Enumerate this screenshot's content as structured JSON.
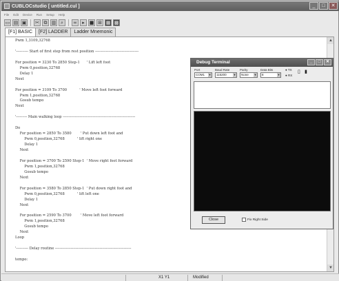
{
  "window": {
    "title": "CUBLOCstudio [ untitled.cul ]"
  },
  "menu": [
    "File",
    "Edit",
    "Device",
    "Run",
    "Setup",
    "Help"
  ],
  "toolbar": [
    "new",
    "open",
    "save",
    "cut",
    "copy",
    "paste",
    "find",
    "run",
    "stop",
    "ladder",
    "monitor",
    "dark-box"
  ],
  "tabs": [
    "[F1] BASIC",
    "[F2] LADDER",
    "Ladder Mnemonic"
  ],
  "code_lines": [
    "Pwm 1,3109,32768",
    "",
    "'---------- Start of first step from rest position ------------------------------------",
    "",
    "For position = 3230 To 2850 Step-1      ' Lift left foot",
    "    Pwm 0,position,32768",
    "    Delay 1",
    "Next",
    "",
    "For position = 3109 To 3700           ' Move left foot forward",
    "    Pwm 1,position,32768",
    "    Gosub tempo",
    "Next",
    "",
    "'--------- Main walking loop ------------------------------------------------------------",
    "",
    "Do",
    "    For position = 2850 To 3580        ' Put down left foot and",
    "        Pwm 0,position,32768           ' lift right one",
    "        Delay 1",
    "    Next",
    "",
    "    For position = 3700 To 2590 Step-1  ' Move right foot forward",
    "        Pwm 1,position,32768",
    "        Gosub tempo",
    "    Next",
    "",
    "    For position = 3580 To 2850 Step-1  ' Put down right foot and",
    "        Pwm 0,position,32768           ' lift left one",
    "        Delay 1",
    "    Next",
    "",
    "    For position = 2590 To 3700        ' Move left foot forward",
    "        Pwm 1,position,32768",
    "        Gosub tempo",
    "    Next",
    "Loop",
    "",
    "'---------- Delay routine ---------------------------------------------------------------",
    "",
    "tempo:"
  ],
  "status": {
    "position": "X1 Y1",
    "state": "Modified"
  },
  "debug": {
    "title": "Debug Terminal",
    "labels": {
      "port": "Port",
      "baud": "Baud Rate",
      "parity": "Parity",
      "databits": "Data Bits"
    },
    "values": {
      "port": "COM1",
      "baud": "115200",
      "parity": "None",
      "databits": "8"
    },
    "radio_tx": "TX",
    "radio_rx": "RX",
    "close_label": "Close",
    "fix_label": "Fix Right Side"
  }
}
